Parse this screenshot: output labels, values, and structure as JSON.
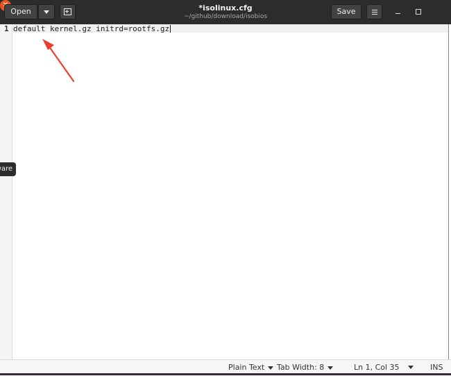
{
  "header": {
    "open_label": "Open",
    "doc_title": "*isolinux.cfg",
    "doc_path": "~/github/download/isobios",
    "save_label": "Save",
    "close_glyph": "✕"
  },
  "editor": {
    "line_number": "1",
    "line_text": "default kernel.gz initrd=rootfs.gz"
  },
  "tooltip": {
    "text": "ware"
  },
  "statusbar": {
    "language": "Plain Text",
    "tab_width": "Tab Width: 8",
    "cursor_position": "Ln 1, Col 35",
    "insert_mode": "INS"
  },
  "icons": [
    "chevron-down-icon",
    "new-tab-icon",
    "hamburger-menu-icon",
    "minimize-icon",
    "maximize-icon",
    "close-icon",
    "red-arrow-annotation"
  ],
  "colors": {
    "accent_close": "#e95420",
    "header_bg": "#2c2c2c",
    "annotation_arrow": "#e8402a"
  }
}
